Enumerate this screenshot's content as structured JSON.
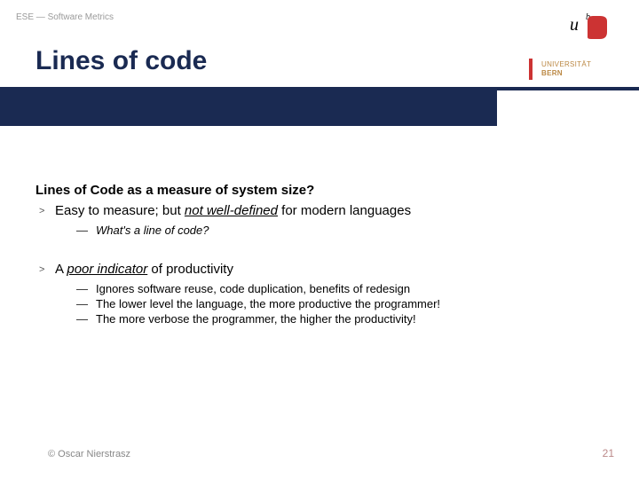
{
  "header": {
    "breadcrumb": "ESE — Software Metrics",
    "title": "Lines of code",
    "logo": {
      "line1": "UNIVERSITÄT",
      "line2": "BERN"
    }
  },
  "body": {
    "lead": "Lines of Code as a measure of system size?",
    "b1": {
      "pre": "Easy to measure; but ",
      "em": "not well-defined",
      "post": " for modern languages",
      "sub1": "What's a line of code?"
    },
    "b2": {
      "pre": "A ",
      "em": "poor indicator",
      "post": " of productivity",
      "sub1": "Ignores software reuse, code duplication, benefits of redesign",
      "sub2": "The lower level the language, the more productive the programmer!",
      "sub3": "The more verbose the programmer, the higher the productivity!"
    }
  },
  "footer": {
    "copyright": "© Oscar Nierstrasz",
    "page": "21"
  },
  "glyph": {
    "gt": ">",
    "dash": "—"
  }
}
